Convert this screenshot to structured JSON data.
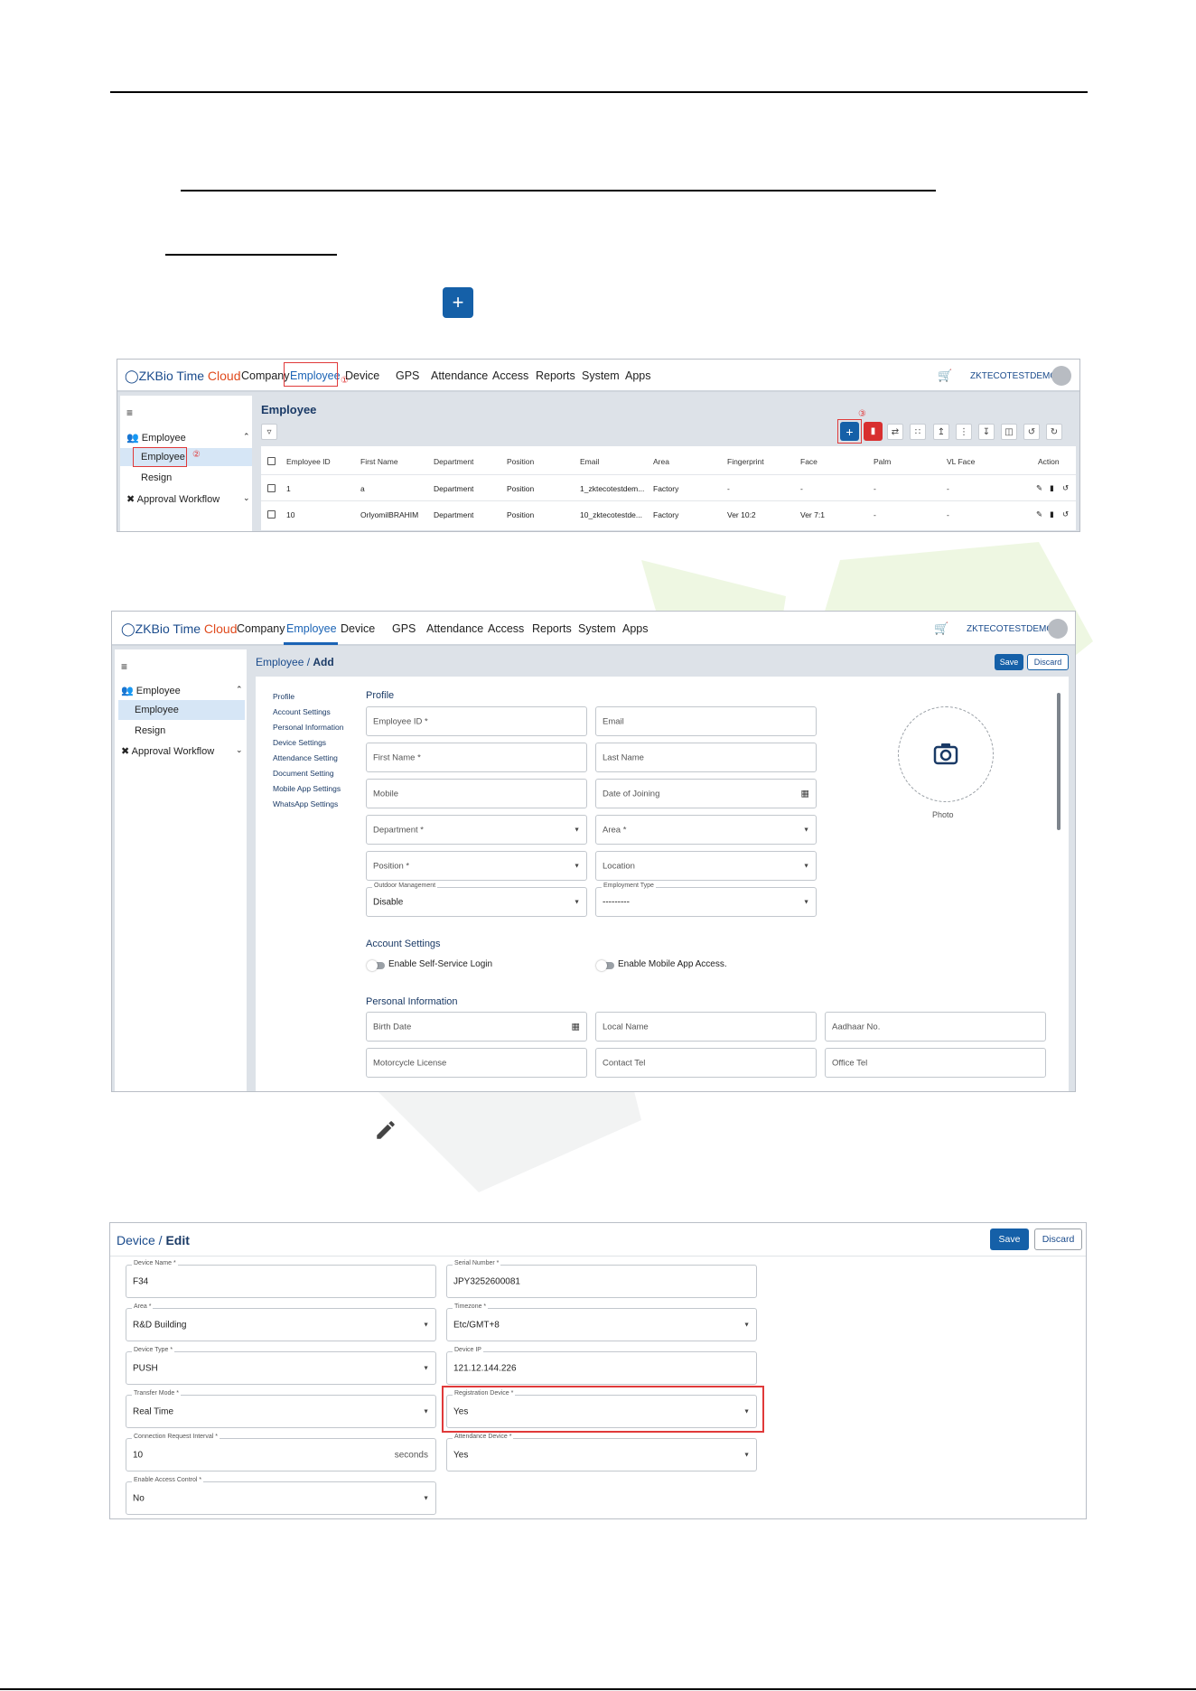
{
  "shot1": {
    "logo_main": "ZKBio Time",
    "logo_cloud": "Cloud",
    "nav": [
      "Company",
      "Employee",
      "Device",
      "GPS",
      "Attendance",
      "Access",
      "Reports",
      "System",
      "Apps"
    ],
    "user": "ZKTECOTESTDEMO",
    "sidebar": {
      "group": "Employee",
      "items": [
        "Employee",
        "Resign"
      ],
      "workflow": "Approval Workflow"
    },
    "page_title": "Employee",
    "markers": [
      "①",
      "②",
      "③"
    ],
    "table": {
      "headers": [
        "Employee ID",
        "First Name",
        "Department",
        "Position",
        "Email",
        "Area",
        "Fingerprint",
        "Face",
        "Palm",
        "VL Face",
        "Action"
      ],
      "rows": [
        [
          "1",
          "a",
          "Department",
          "Position",
          "1_zktecotestdem...",
          "Factory",
          "-",
          "-",
          "-",
          "-"
        ],
        [
          "10",
          "OrlyomilBRAHIM",
          "Department",
          "Position",
          "10_zktecotestde...",
          "Factory",
          "Ver 10:2",
          "Ver 7:1",
          "-",
          "-"
        ]
      ]
    }
  },
  "shot2": {
    "logo_main": "ZKBio Time",
    "logo_cloud": "Cloud",
    "nav": [
      "Company",
      "Employee",
      "Device",
      "GPS",
      "Attendance",
      "Access",
      "Reports",
      "System",
      "Apps"
    ],
    "user": "ZKTECOTESTDEMO",
    "sidebar": {
      "group": "Employee",
      "items": [
        "Employee",
        "Resign"
      ],
      "workflow": "Approval Workflow"
    },
    "crumb_parent": "Employee",
    "crumb_current": "Add",
    "save": "Save",
    "discard": "Discard",
    "anchors": [
      "Profile",
      "Account Settings",
      "Personal Information",
      "Device Settings",
      "Attendance Setting",
      "Document Setting",
      "Mobile App Settings",
      "WhatsApp Settings"
    ],
    "profile_title": "Profile",
    "fields": {
      "employee_id": "Employee ID *",
      "email": "Email",
      "first_name": "First Name *",
      "last_name": "Last Name",
      "mobile": "Mobile",
      "date_joining": "Date of Joining",
      "department": "Department *",
      "area": "Area *",
      "position": "Position *",
      "location": "Location",
      "outdoor_label": "Outdoor Management",
      "outdoor_value": "Disable",
      "emp_type_label": "Employment Type",
      "emp_type_value": "---------"
    },
    "photo": "Photo",
    "account_title": "Account Settings",
    "toggle_self": "Enable Self-Service Login",
    "toggle_mobile": "Enable Mobile App Access.",
    "personal_title": "Personal Information",
    "personal_fields": [
      "Birth Date",
      "Local Name",
      "Aadhaar No.",
      "Motorcycle License",
      "Contact Tel",
      "Office Tel"
    ]
  },
  "shot3": {
    "crumb_parent": "Device",
    "crumb_current": "Edit",
    "save": "Save",
    "discard": "Discard",
    "fields": [
      {
        "label": "Device Name *",
        "value": "F34"
      },
      {
        "label": "Serial Number *",
        "value": "JPY3252600081"
      },
      {
        "label": "Area *",
        "value": "R&D Building"
      },
      {
        "label": "Timezone *",
        "value": "Etc/GMT+8"
      },
      {
        "label": "Device Type *",
        "value": "PUSH"
      },
      {
        "label": "Device IP",
        "value": "121.12.144.226"
      },
      {
        "label": "Transfer Mode *",
        "value": "Real Time"
      },
      {
        "label": "Registration Device *",
        "value": "Yes"
      },
      {
        "label": "Connection Request Interval *",
        "value": "10",
        "suffix": "seconds"
      },
      {
        "label": "Attendance Device *",
        "value": "Yes"
      },
      {
        "label": "Enable Access Control *",
        "value": "No"
      }
    ]
  },
  "colors": {
    "accent": "#1560a8",
    "danger": "#d82f2f",
    "highlight": "#e03a3a",
    "brand_orange": "#e04b1e"
  }
}
